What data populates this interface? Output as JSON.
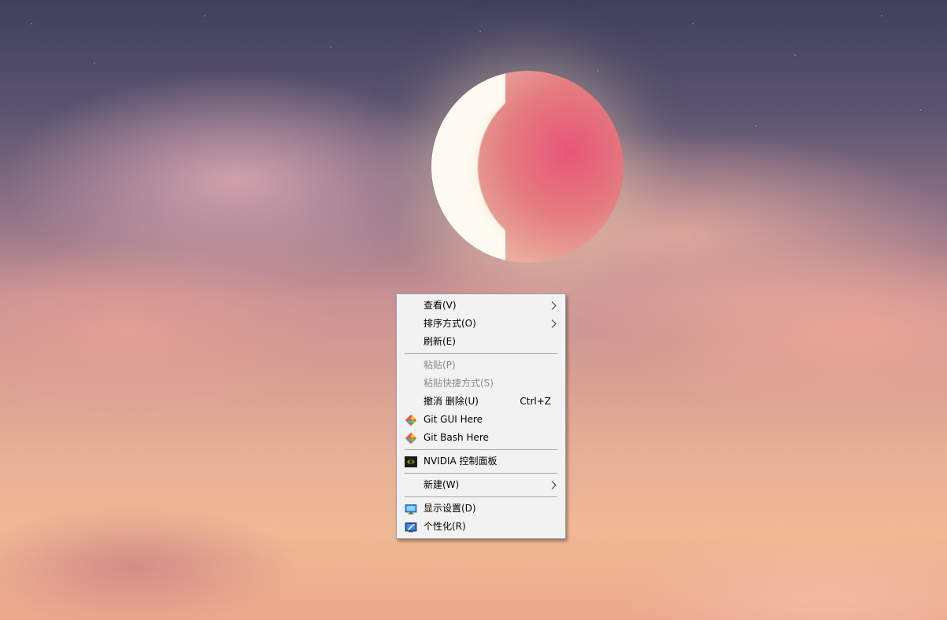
{
  "desktop": {
    "wallpaper": "pink-cloudy-sky-with-moon"
  },
  "context_menu": {
    "items": [
      {
        "label": "查看(V)",
        "submenu": true
      },
      {
        "label": "排序方式(O)",
        "submenu": true
      },
      {
        "label": "刷新(E)"
      },
      {
        "label": "粘贴(P)",
        "disabled": true
      },
      {
        "label": "粘贴快捷方式(S)",
        "disabled": true
      },
      {
        "label": "撤消 删除(U)",
        "shortcut": "Ctrl+Z"
      },
      {
        "label": "Git GUI Here",
        "icon": "git-icon"
      },
      {
        "label": "Git Bash Here",
        "icon": "git-icon"
      },
      {
        "label": "NVIDIA 控制面板",
        "icon": "nvidia-icon"
      },
      {
        "label": "新建(W)",
        "submenu": true
      },
      {
        "label": "显示设置(D)",
        "icon": "display-settings-icon"
      },
      {
        "label": "个性化(R)",
        "icon": "personalize-icon"
      }
    ]
  },
  "colors": {
    "menu_bg": "#f2f2f2",
    "menu_border": "#a0a0a0",
    "disabled_text": "#8d8d8d",
    "separator": "#a8a8a8"
  }
}
